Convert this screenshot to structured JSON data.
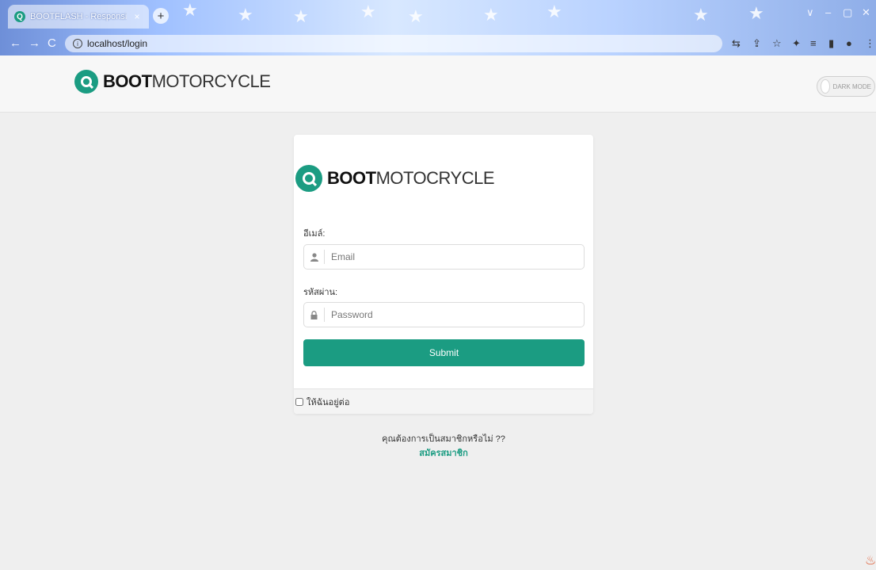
{
  "browser": {
    "tab_title": "BOOTFLASH - Responsive Cl",
    "tab_close": "×",
    "new_tab": "+",
    "url": "localhost/login",
    "window_controls": [
      "∨",
      "–",
      "▢",
      "✕"
    ],
    "nav": {
      "back": "←",
      "forward": "→",
      "reload": "C"
    },
    "toolbar_icons": [
      "translate-icon",
      "share-icon",
      "star-icon",
      "extension-icon",
      "queue-icon",
      "sidebar-icon",
      "profile-icon",
      "menu-icon"
    ]
  },
  "header": {
    "brand_bold": "BOOT",
    "brand_light": "MOTORCYCLE",
    "dark_mode_label": "DARK MODE"
  },
  "card": {
    "brand_bold": "BOOT",
    "brand_light": "MOTOCRYCLE",
    "email_label": "อีเมล์:",
    "email_placeholder": "Email",
    "password_label": "รหัสผ่าน:",
    "password_placeholder": "Password",
    "submit_label": "Submit",
    "remember_label": "ให้ฉันอยู่ต่อ"
  },
  "register": {
    "question": "คุณต้องการเป็นสมาชิกหรือไม่ ??",
    "link": "สมัครสมาชิก"
  },
  "colors": {
    "accent": "#1b9c82",
    "page_bg": "#efefef",
    "header_bg": "#f7f7f7"
  }
}
